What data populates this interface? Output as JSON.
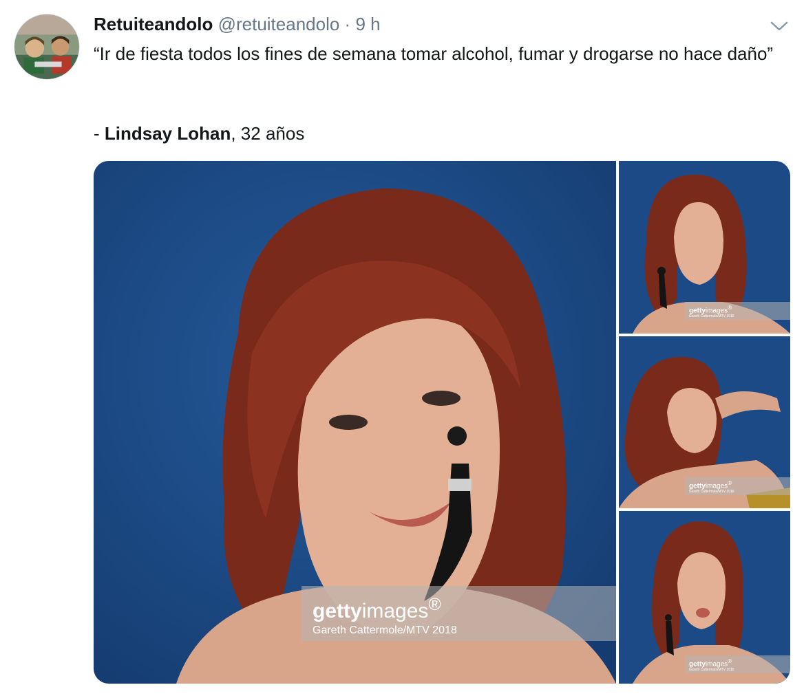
{
  "tweet": {
    "author_name": "Retuiteandolo",
    "author_handle": "@retuiteandolo",
    "separator": "·",
    "timestamp": "9 h",
    "text": "“Ir de fiesta todos los fines de semana tomar alcohol, fumar y drogarse no hace daño”",
    "attribution_prefix": "- ",
    "attribution_name": "Lindsay Lohan",
    "attribution_suffix": ", 32 años"
  },
  "media": {
    "photos": [
      {
        "watermark_bold": "getty",
        "watermark_rest": "images",
        "watermark_mark": "®",
        "credit": "Gareth Cattermole/MTV 2018"
      },
      {
        "watermark_bold": "getty",
        "watermark_rest": "images",
        "watermark_mark": "®",
        "credit": "Gareth Cattermole/MTV 2018"
      },
      {
        "watermark_bold": "getty",
        "watermark_rest": "images",
        "watermark_mark": "®",
        "credit": "Gareth Cattermole/MTV 2018"
      },
      {
        "watermark_bold": "getty",
        "watermark_rest": "images",
        "watermark_mark": "®",
        "credit": "Gareth Cattermole/MTV 2018"
      }
    ]
  },
  "icons": {
    "caret": "chevron-down-icon",
    "avatar": "avatar"
  },
  "colors": {
    "text": "#14171a",
    "secondary": "#657786",
    "photo_background": "#1b4a86",
    "hair": "#7a2a1a"
  }
}
